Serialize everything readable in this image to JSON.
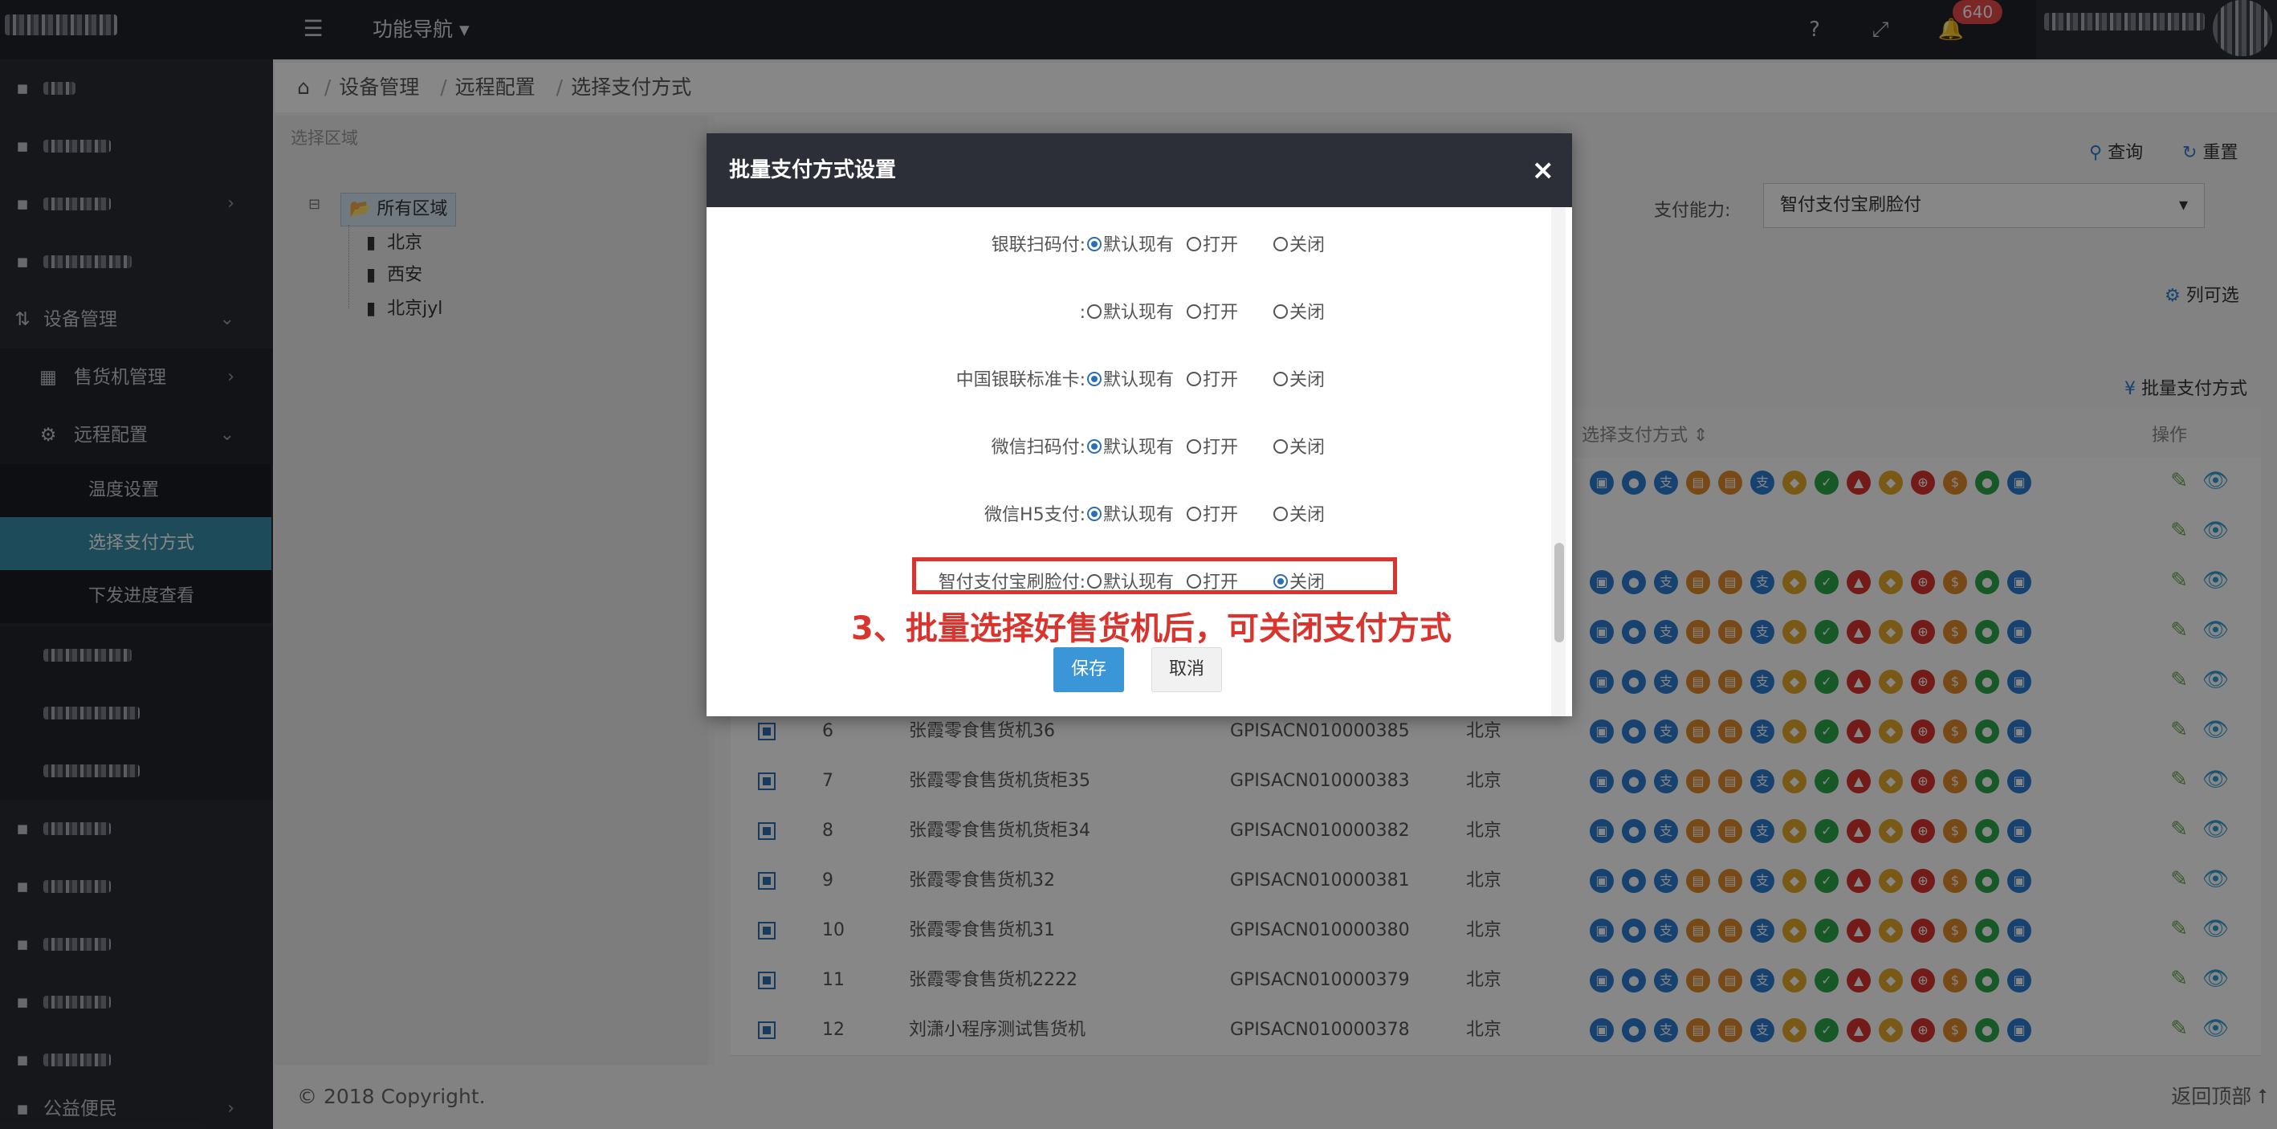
{
  "topbar": {
    "func_nav_label": "功能导航 ▾",
    "notification_count": "640",
    "icons": [
      "help-icon",
      "fullscreen-icon",
      "bell-icon"
    ]
  },
  "sidebar": {
    "device_mgmt": "设备管理",
    "vending_mgmt": "售货机管理",
    "remote_config": "远程配置",
    "leaf_temp": "温度设置",
    "leaf_payment": "选择支付方式",
    "leaf_progress": "下发进度查看",
    "public_welfare": "公益便民"
  },
  "breadcrumb": [
    "设备管理",
    "远程配置",
    "选择支付方式"
  ],
  "region": {
    "title": "选择区域",
    "root": "所有区域",
    "children": [
      "北京",
      "西安",
      "北京jyl"
    ]
  },
  "main": {
    "query_label": "查询",
    "reset_label": "重置",
    "pay_ability_label": "支付能力:",
    "pay_ability_value": "智付支付宝刷脸付",
    "column_select": "列可选",
    "batch_payment": "批量支付方式",
    "col_payment": "选择支付方式",
    "col_ops": "操作"
  },
  "table_rows": [
    {
      "no": "6",
      "name": "张霞零食售货机36",
      "code": "GPISACN010000385",
      "area": "北京"
    },
    {
      "no": "7",
      "name": "张霞零食售货机货柜35",
      "code": "GPISACN010000383",
      "area": "北京"
    },
    {
      "no": "8",
      "name": "张霞零食售货机货柜34",
      "code": "GPISACN010000382",
      "area": "北京"
    },
    {
      "no": "9",
      "name": "张霞零食售货机32",
      "code": "GPISACN010000381",
      "area": "北京"
    },
    {
      "no": "10",
      "name": "张霞零食售货机31",
      "code": "GPISACN010000380",
      "area": "北京"
    },
    {
      "no": "11",
      "name": "张霞零食售货机2222",
      "code": "GPISACN010000379",
      "area": "北京"
    },
    {
      "no": "12",
      "name": "刘潇小程序测试售货机",
      "code": "GPISACN010000378",
      "area": "北京"
    }
  ],
  "footer": {
    "copyright": "© 2018 Copyright.",
    "back_top": "返回顶部 ⭡"
  },
  "modal": {
    "title": "批量支付方式设置",
    "close": "×",
    "option_default": "默认现有",
    "option_on": "打开",
    "option_off": "关闭",
    "rows": [
      {
        "label": "银联扫码付:",
        "selected": "default"
      },
      {
        "label": ":",
        "selected": "none"
      },
      {
        "label": "中国银联标准卡:",
        "selected": "default"
      },
      {
        "label": "微信扫码付:",
        "selected": "default"
      },
      {
        "label": "微信H5支付:",
        "selected": "default"
      },
      {
        "label": "智付支付宝刷脸付:",
        "selected": "off"
      }
    ],
    "annotation": "3、批量选择好售货机后，可关闭支付方式",
    "save": "保存",
    "cancel": "取消"
  },
  "colors": {
    "accent": "#3a96d6",
    "highlight": "#d9342e",
    "sidebar_active": "#3a8ea8"
  }
}
